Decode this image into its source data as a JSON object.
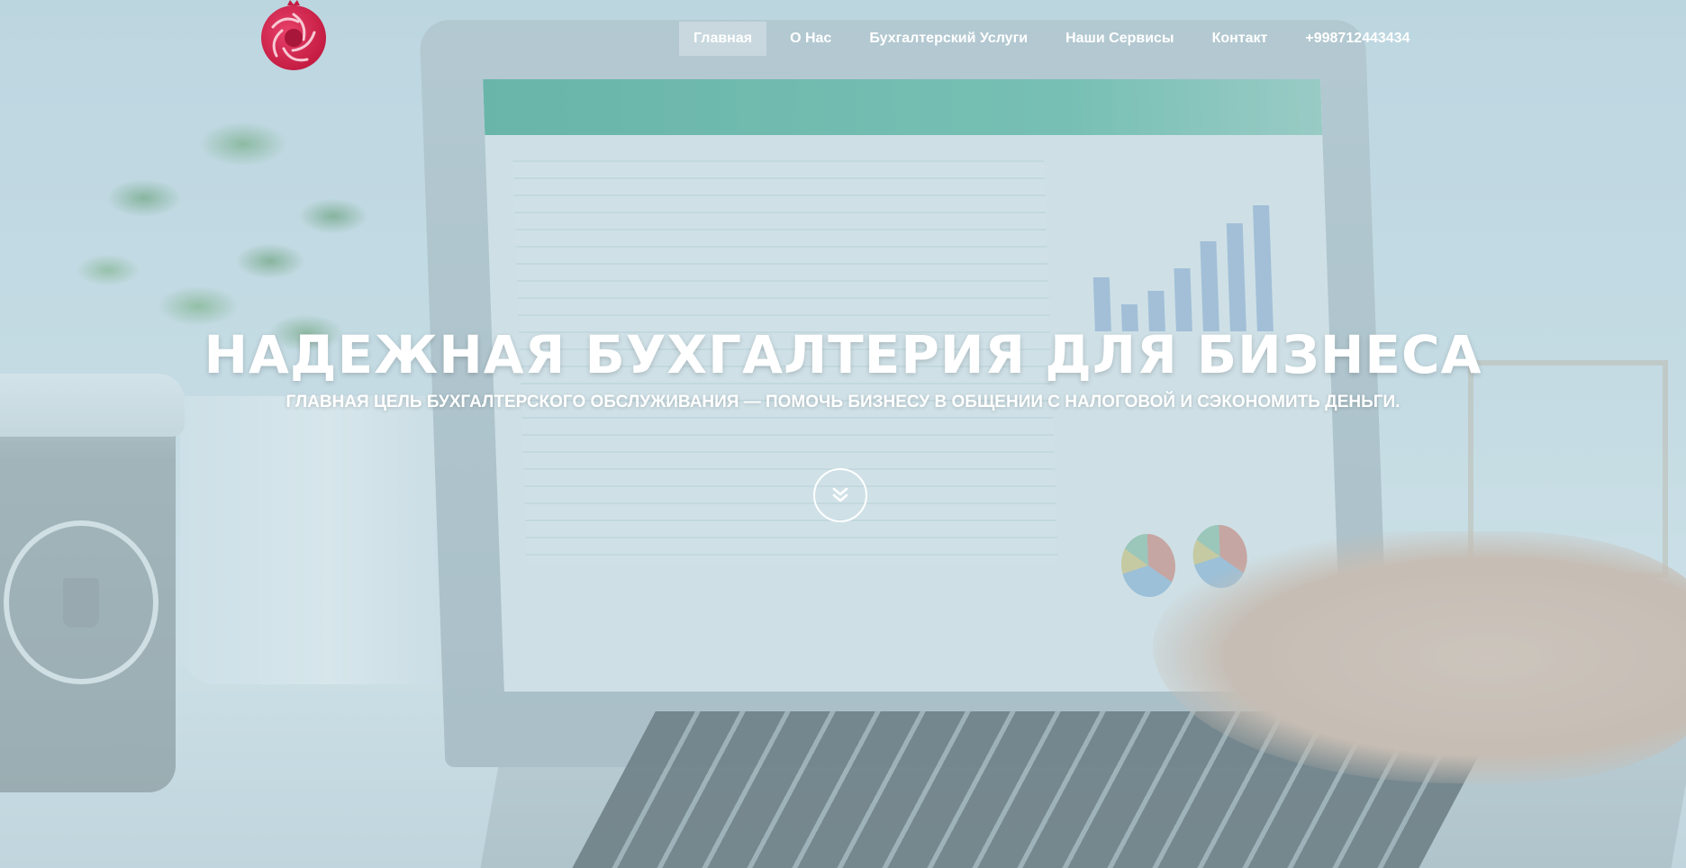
{
  "brand": {
    "logo_icon": "pomegranate-aperture-logo",
    "logo_color": "#d1234a"
  },
  "nav": {
    "items": [
      {
        "label": "Главная",
        "active": true
      },
      {
        "label": "О Нас",
        "active": false
      },
      {
        "label": "Бухгалтерский Услуги",
        "active": false
      },
      {
        "label": "Наши Сервисы",
        "active": false
      },
      {
        "label": "Контакт",
        "active": false
      },
      {
        "label": "+998712443434",
        "active": false
      }
    ]
  },
  "hero": {
    "title": "НАДЕЖНАЯ БУХГАЛТЕРИЯ ДЛЯ БИЗНЕСА",
    "subtitle": "ГЛАВНАЯ ЦЕЛЬ БУХГАЛТЕРСКОГО ОБСЛУЖИВАНИЯ — ПОМОЧЬ БИЗНЕСУ В ОБЩЕНИИ С НАЛОГОВОЙ И СЭКОНОМИТЬ ДЕНЬГИ.",
    "scroll_icon": "double-chevron-down-icon"
  },
  "colors": {
    "overlay": "#acceda",
    "text": "#ffffff"
  }
}
